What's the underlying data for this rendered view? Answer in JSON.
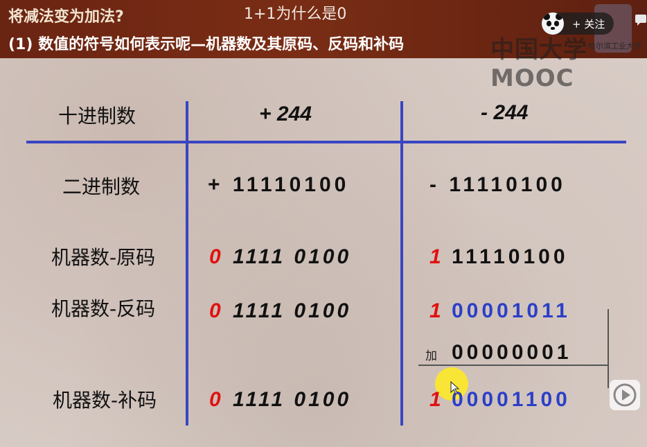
{
  "header": {
    "title": "将减法变为加法?",
    "subtitle": "(1) 数值的符号如何表示呢—机器数及其原码、反码和补码",
    "video_title": "1+1为什么是0",
    "watermark": "中国大学MOOC",
    "badge_text": "一哈尔滨工业大学",
    "follow_label": "+ 关注"
  },
  "table": {
    "headers": {
      "row_label": "十进制数",
      "positive": "+ 244",
      "negative": "- 244"
    },
    "binary": {
      "label": "二进制数",
      "positive": "+ 11110100",
      "negative": "- 11110100"
    },
    "sign_magnitude": {
      "label": "机器数-原码",
      "positive_sign": "0",
      "positive_bits": "1111 0100",
      "negative_sign": "1",
      "negative_bits": "11110100"
    },
    "ones_complement": {
      "label": "机器数-反码",
      "positive_sign": "0",
      "positive_bits": "1111 0100",
      "negative_sign": "1",
      "negative_bits": "00001011"
    },
    "addition": {
      "label": "加",
      "bits": "00000001"
    },
    "twos_complement": {
      "label": "机器数-补码",
      "positive_sign": "0",
      "positive_bits": "1111 0100",
      "negative_sign": "1",
      "negative_bits": "00001100"
    }
  },
  "icons": {
    "avatar": "panda-avatar-icon",
    "comment": "comment-icon",
    "play": "play-icon",
    "cursor": "cursor-icon"
  },
  "colors": {
    "sign_bit": "#e01010",
    "inverted_bits": "#2b3fc8",
    "rule_lines": "#3a45c2",
    "header_bg": "#6a2412"
  }
}
